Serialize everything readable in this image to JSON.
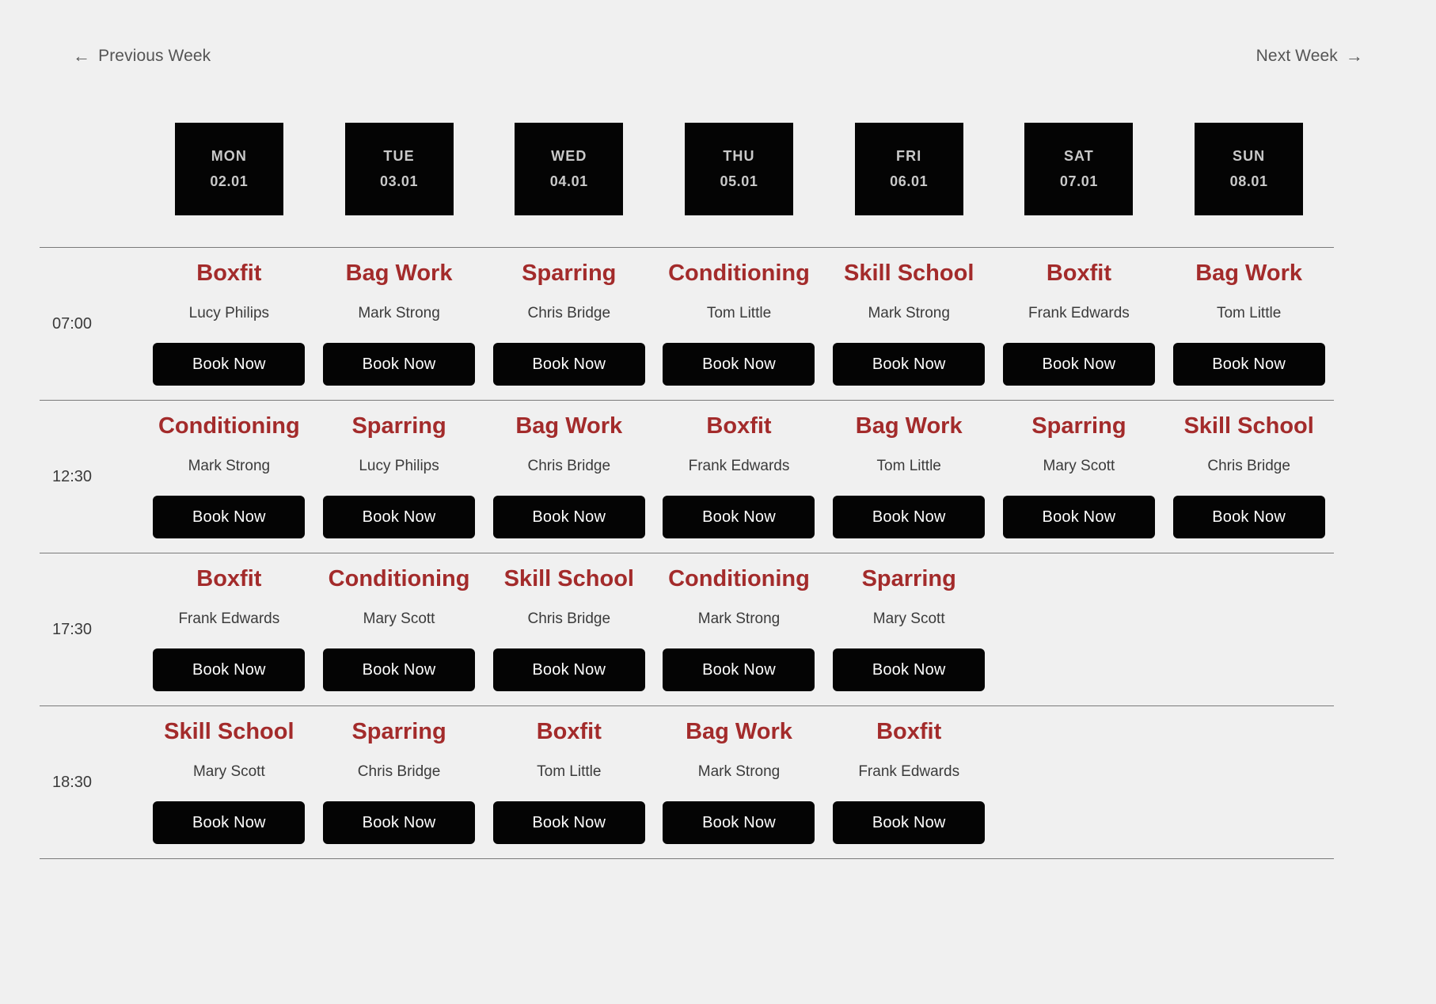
{
  "nav": {
    "previous_label": "Previous Week",
    "previous_arrow": "←",
    "next_label": "Next Week",
    "next_arrow": "→"
  },
  "colors": {
    "page_background": "#f0f0f0",
    "class_title": "#a32b2b",
    "button_background": "#040404",
    "button_text": "#ffffff",
    "day_header_background": "#040404",
    "day_header_text": "#c9c9c9",
    "divider": "#7a7a7a",
    "body_text": "#3b3b3b",
    "nav_text": "#555555"
  },
  "book_label": "Book Now",
  "days": [
    {
      "name": "MON",
      "date": "02.01"
    },
    {
      "name": "TUE",
      "date": "03.01"
    },
    {
      "name": "WED",
      "date": "04.01"
    },
    {
      "name": "THU",
      "date": "05.01"
    },
    {
      "name": "FRI",
      "date": "06.01"
    },
    {
      "name": "SAT",
      "date": "07.01"
    },
    {
      "name": "SUN",
      "date": "08.01"
    }
  ],
  "rows": [
    {
      "time": "07:00",
      "classes": [
        {
          "title": "Boxfit",
          "instructor": "Lucy Philips",
          "book": "Book Now"
        },
        {
          "title": "Bag Work",
          "instructor": "Mark Strong",
          "book": "Book Now"
        },
        {
          "title": "Sparring",
          "instructor": "Chris Bridge",
          "book": "Book Now"
        },
        {
          "title": "Conditioning",
          "instructor": "Tom Little",
          "book": "Book Now"
        },
        {
          "title": "Skill School",
          "instructor": "Mark Strong",
          "book": "Book Now"
        },
        {
          "title": "Boxfit",
          "instructor": "Frank Edwards",
          "book": "Book Now"
        },
        {
          "title": "Bag Work",
          "instructor": "Tom Little",
          "book": "Book Now"
        }
      ]
    },
    {
      "time": "12:30",
      "classes": [
        {
          "title": "Conditioning",
          "instructor": "Mark Strong",
          "book": "Book Now"
        },
        {
          "title": "Sparring",
          "instructor": "Lucy Philips",
          "book": "Book Now"
        },
        {
          "title": "Bag Work",
          "instructor": "Chris Bridge",
          "book": "Book Now"
        },
        {
          "title": "Boxfit",
          "instructor": "Frank Edwards",
          "book": "Book Now"
        },
        {
          "title": "Bag Work",
          "instructor": "Tom Little",
          "book": "Book Now"
        },
        {
          "title": "Sparring",
          "instructor": "Mary Scott",
          "book": "Book Now"
        },
        {
          "title": "Skill School",
          "instructor": "Chris Bridge",
          "book": "Book Now"
        }
      ]
    },
    {
      "time": "17:30",
      "classes": [
        {
          "title": "Boxfit",
          "instructor": "Frank Edwards",
          "book": "Book Now"
        },
        {
          "title": "Conditioning",
          "instructor": "Mary Scott",
          "book": "Book Now"
        },
        {
          "title": "Skill School",
          "instructor": "Chris Bridge",
          "book": "Book Now"
        },
        {
          "title": "Conditioning",
          "instructor": "Mark Strong",
          "book": "Book Now"
        },
        {
          "title": "Sparring",
          "instructor": "Mary Scott",
          "book": "Book Now"
        },
        null,
        null
      ]
    },
    {
      "time": "18:30",
      "classes": [
        {
          "title": "Skill School",
          "instructor": "Mary Scott",
          "book": "Book Now"
        },
        {
          "title": "Sparring",
          "instructor": "Chris Bridge",
          "book": "Book Now"
        },
        {
          "title": "Boxfit",
          "instructor": "Tom Little",
          "book": "Book Now"
        },
        {
          "title": "Bag Work",
          "instructor": "Mark Strong",
          "book": "Book Now"
        },
        {
          "title": "Boxfit",
          "instructor": "Frank Edwards",
          "book": "Book Now"
        },
        null,
        null
      ]
    }
  ]
}
